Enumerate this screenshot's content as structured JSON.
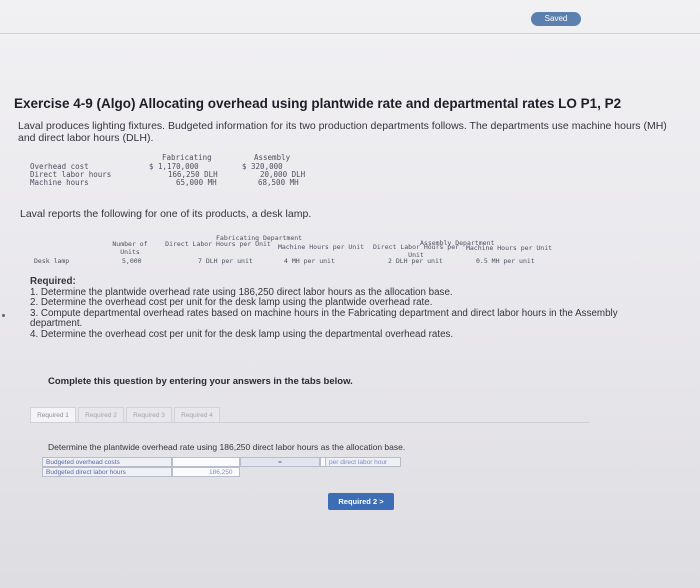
{
  "status": {
    "saved_label": "Saved"
  },
  "title": "Exercise 4-9 (Algo) Allocating overhead using plantwide rate and departmental rates LO P1, P2",
  "intro": "Laval produces lighting fixtures. Budgeted information for its two production departments follows. The departments use machine hours (MH) and direct labor hours (DLH).",
  "budget_table": {
    "headers": [
      "Fabricating",
      "Assembly"
    ],
    "rows": [
      {
        "label": "Overhead cost",
        "fabricating": "$ 1,170,000",
        "assembly": "$ 320,000"
      },
      {
        "label": "Direct labor hours",
        "fabricating": "166,250 DLH",
        "assembly": "20,000 DLH"
      },
      {
        "label": "Machine hours",
        "fabricating": "65,000 MH",
        "assembly": "68,500 MH"
      }
    ]
  },
  "reports_text": "Laval reports the following for one of its products, a desk lamp.",
  "product_table": {
    "group_headers": [
      "Fabricating Department",
      "Assembly Department"
    ],
    "col_headers": [
      "Number of Units",
      "Direct Labor Hours per Unit",
      "Machine Hours per Unit",
      "Direct Labor Hours per Unit",
      "Machine Hours per Unit"
    ],
    "row": {
      "label": "Desk lamp",
      "units": "5,000",
      "fab_dlh": "7 DLH per unit",
      "fab_mh": "4 MH per unit",
      "asm_dlh": "2 DLH per unit",
      "asm_mh": "0.5 MH per unit"
    }
  },
  "required": {
    "heading": "Required:",
    "items": [
      "1. Determine the plantwide overhead rate using 186,250 direct labor hours as the allocation base.",
      "2. Determine the overhead cost per unit for the desk lamp using the plantwide overhead rate.",
      "3. Compute departmental overhead rates based on machine hours in the Fabricating department and direct labor hours in the Assembly department.",
      "4. Determine the overhead cost per unit for the desk lamp using the departmental overhead rates."
    ]
  },
  "complete_text": "Complete this question by entering your answers in the tabs below.",
  "tabs": [
    "Required 1",
    "Required 2",
    "Required 3",
    "Required 4"
  ],
  "active_tab_index": 0,
  "determine_text": "Determine the plantwide overhead rate using 186,250 direct labor hours as the allocation base.",
  "calc": {
    "row1_label": "Budgeted overhead costs",
    "row2_label": "Budgeted direct labor hours",
    "row2_value": "186,250",
    "op_symbol": "=",
    "unit_label": "per direct labor hour"
  },
  "next_button": "Required 2  >"
}
